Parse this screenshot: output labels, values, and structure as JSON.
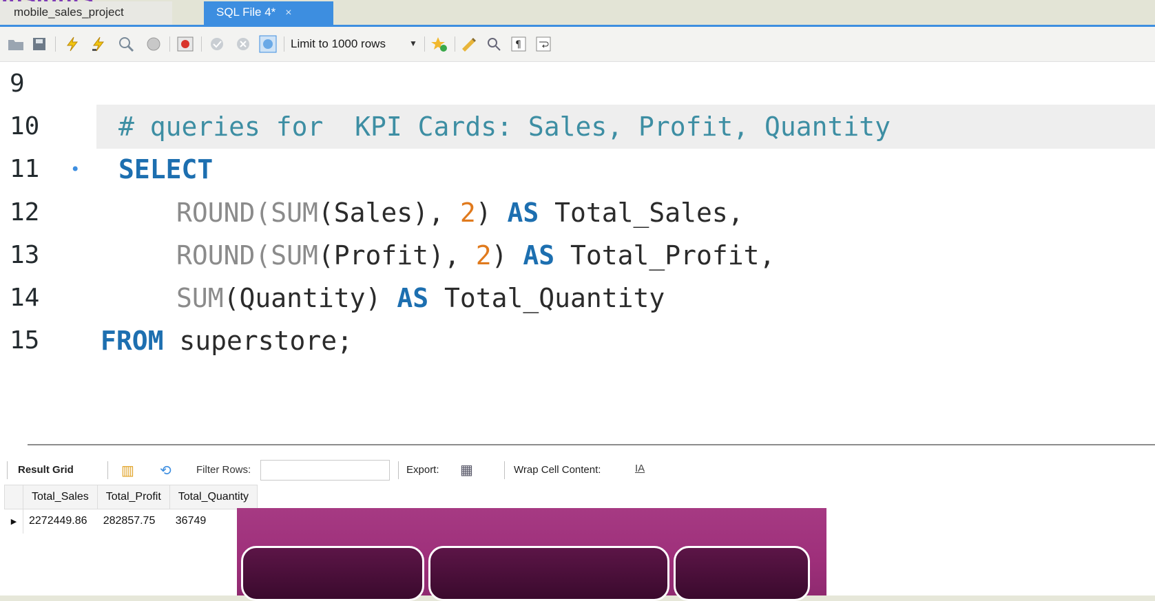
{
  "caption": "Insights:",
  "tabs": [
    {
      "label": "mobile_sales_project",
      "active": false
    },
    {
      "label": "SQL File 4*",
      "active": true,
      "close": "×"
    }
  ],
  "toolbar": {
    "limit_label": "Limit to 1000 rows",
    "icons": [
      "open-folder-icon",
      "save-icon",
      "execute-icon",
      "execute-current-icon",
      "explain-icon",
      "stop-icon",
      "toggle-continue-icon",
      "commit-icon",
      "rollback-icon",
      "autocommit-icon",
      "add-snippet-icon",
      "beautify-icon",
      "find-icon",
      "invisible-chars-icon",
      "wrap-icon"
    ]
  },
  "editor": {
    "lines": [
      {
        "number": "9",
        "text": ""
      },
      {
        "number": "10",
        "comment": "# queries for  KPI Cards: Sales, Profit, Quantity"
      },
      {
        "number": "11",
        "bullet": "•",
        "kw": "SELECT"
      },
      {
        "number": "12",
        "fn1": "ROUND(SUM",
        "p1": "(Sales), ",
        "num": "2",
        "p2": ") ",
        "kw": "AS",
        "id": " Total_Sales,"
      },
      {
        "number": "13",
        "fn1": "ROUND(SUM",
        "p1": "(Profit), ",
        "num": "2",
        "p2": ") ",
        "kw": "AS",
        "id": " Total_Profit,"
      },
      {
        "number": "14",
        "fn1": "SUM",
        "p1": "(Quantity) ",
        "kw": "AS",
        "id": " Total_Quantity"
      },
      {
        "number": "15",
        "kw": "FROM",
        "id": " superstore;"
      }
    ]
  },
  "results": {
    "result_grid_label": "Result Grid",
    "filter_rows_label": "Filter Rows:",
    "filter_value": "",
    "export_label": "Export:",
    "wrap_label": "Wrap Cell Content:",
    "wrap_icon": "IA",
    "columns": [
      "Total_Sales",
      "Total_Profit",
      "Total_Quantity"
    ],
    "rows": [
      [
        "2272449.86",
        "282857.75",
        "36749"
      ]
    ]
  },
  "colors": {
    "tab_active": "#3d8ee0",
    "keyword": "#1d6fb0",
    "comment": "#3d8ea3",
    "number": "#e07a1d",
    "card": "#a63a83"
  }
}
